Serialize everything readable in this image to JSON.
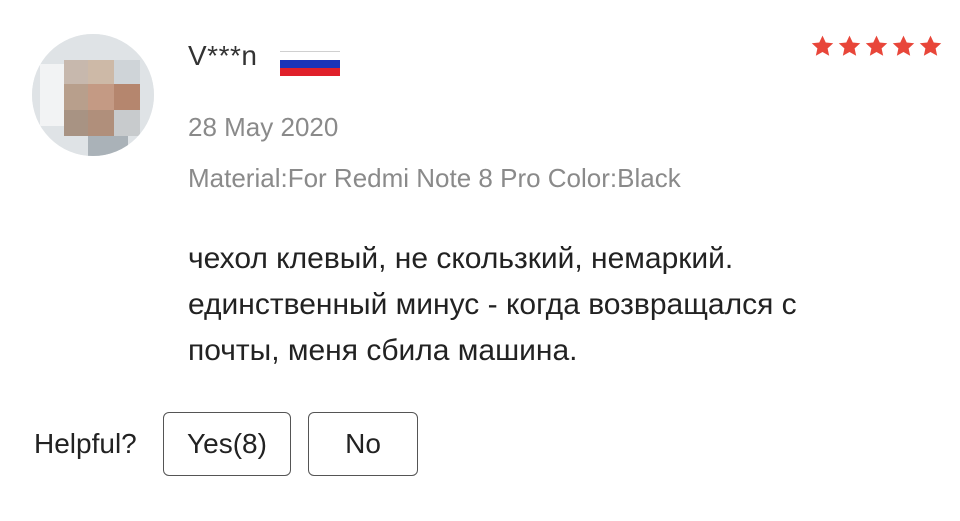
{
  "review": {
    "avatar_icon": "user-avatar-pixelated",
    "username": "V***n",
    "country_flag_icon": "flag-ru-icon",
    "rating": 5,
    "rating_max": 5,
    "star_color": "#e8463a",
    "date": "28 May 2020",
    "sku": "Material:For Redmi Note 8 Pro Color:Black",
    "text_lines": [
      "чехол клевый, не скользкий, немаркий.",
      "единственный минус - когда возвращался с",
      "почты, меня сбила машина."
    ]
  },
  "helpful": {
    "label": "Helpful?",
    "yes_label": "Yes(8)",
    "no_label": "No"
  }
}
